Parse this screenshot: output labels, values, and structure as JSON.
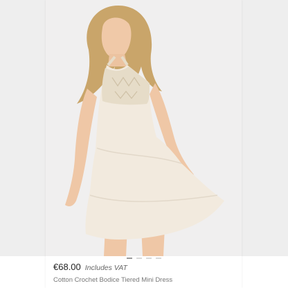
{
  "listing": {
    "price": "€68.00",
    "vat_note": "Includes VAT",
    "title": "Cotton Crochet Bodice Tiered Mini Dress"
  },
  "image": {
    "subject": "model wearing cream tiered mini dress with crochet halter bodice",
    "background": "#f0efef",
    "dress_color": "#f2eade",
    "hair_color": "#c9a56a"
  },
  "gallery": {
    "dot_count": 4,
    "active_index": 0
  }
}
